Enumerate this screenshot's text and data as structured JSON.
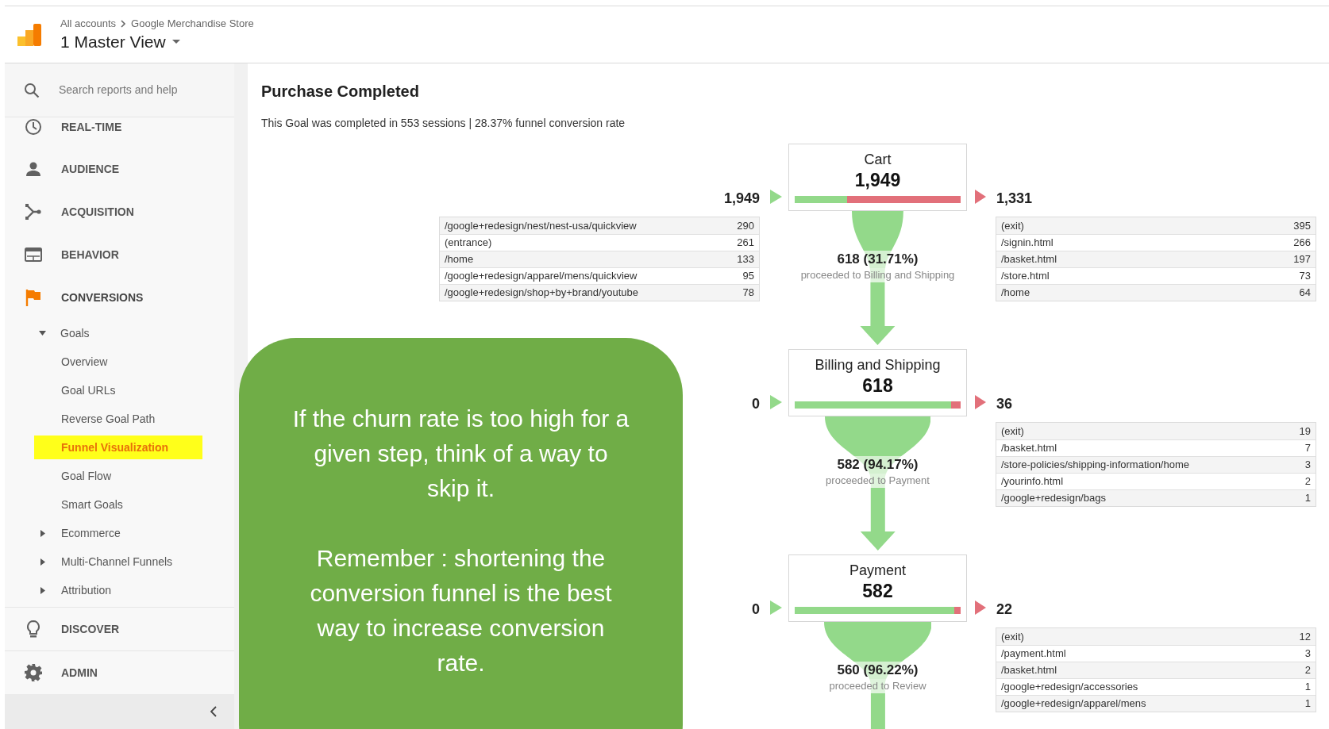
{
  "header": {
    "breadcrumb": [
      "All accounts",
      "Google Merchandise Store"
    ],
    "view": "1 Master View"
  },
  "sidebar": {
    "search": {
      "placeholder": "Search reports and help"
    },
    "sections": [
      {
        "label": "REAL-TIME",
        "selected": false
      },
      {
        "label": "AUDIENCE",
        "selected": false
      },
      {
        "label": "ACQUISITION",
        "selected": false
      },
      {
        "label": "BEHAVIOR",
        "selected": false
      },
      {
        "label": "CONVERSIONS",
        "selected": true,
        "children": [
          {
            "label": "Goals",
            "expanded": true,
            "children": [
              {
                "label": "Overview",
                "selected": false
              },
              {
                "label": "Goal URLs",
                "selected": false
              },
              {
                "label": "Reverse Goal Path",
                "selected": false
              },
              {
                "label": "Funnel Visualization",
                "selected": true
              },
              {
                "label": "Goal Flow",
                "selected": false
              },
              {
                "label": "Smart Goals",
                "selected": false
              }
            ]
          },
          {
            "label": "Ecommerce",
            "expanded": false
          },
          {
            "label": "Multi-Channel Funnels",
            "expanded": false
          },
          {
            "label": "Attribution",
            "expanded": false
          }
        ]
      }
    ],
    "footer_sections": [
      {
        "label": "DISCOVER",
        "selected": false
      },
      {
        "label": "ADMIN",
        "selected": false
      }
    ]
  },
  "report": {
    "title": "Purchase Completed",
    "summary": "This Goal was completed in 553 sessions | 28.37% funnel conversion rate",
    "steps": [
      {
        "name": "Cart",
        "count": "1,949",
        "level": 0.3171,
        "entrances": "1,949",
        "entrance_pages": [
          {
            "page": "/google+redesign/nest/nest-usa/quickview",
            "count": "290"
          },
          {
            "page": "(entrance)",
            "count": "261"
          },
          {
            "page": "/home",
            "count": "133"
          },
          {
            "page": "/google+redesign/apparel/mens/quickview",
            "count": "95"
          },
          {
            "page": "/google+redesign/shop+by+brand/youtube",
            "count": "78"
          }
        ],
        "exits": "1,331",
        "exit_pages": [
          {
            "page": "(exit)",
            "count": "395"
          },
          {
            "page": "/signin.html",
            "count": "266"
          },
          {
            "page": "/basket.html",
            "count": "197"
          },
          {
            "page": "/store.html",
            "count": "73"
          },
          {
            "page": "/home",
            "count": "64"
          }
        ],
        "proceeded": "618 (31.71%)",
        "proceeded_label": "proceeded to Billing and Shipping"
      },
      {
        "name": "Billing and Shipping",
        "count": "618",
        "level": 0.9417,
        "entrances": "0",
        "exits": "36",
        "exit_pages": [
          {
            "page": "(exit)",
            "count": "19"
          },
          {
            "page": "/basket.html",
            "count": "7"
          },
          {
            "page": "/store-policies/shipping-information/home",
            "count": "3"
          },
          {
            "page": "/yourinfo.html",
            "count": "2"
          },
          {
            "page": "/google+redesign/bags",
            "count": "1"
          }
        ],
        "proceeded": "582 (94.17%)",
        "proceeded_label": "proceeded to Payment"
      },
      {
        "name": "Payment",
        "count": "582",
        "level": 0.9622,
        "entrances": "0",
        "exits": "22",
        "exit_pages": [
          {
            "page": "(exit)",
            "count": "12"
          },
          {
            "page": "/payment.html",
            "count": "3"
          },
          {
            "page": "/basket.html",
            "count": "2"
          },
          {
            "page": "/google+redesign/accessories",
            "count": "1"
          },
          {
            "page": "/google+redesign/apparel/mens",
            "count": "1"
          }
        ],
        "proceeded": "560 (96.22%)",
        "proceeded_label": "proceeded to Review"
      }
    ]
  },
  "callout": {
    "paragraphs": [
      "If the churn rate is too high for a given step, think of a way to skip it.",
      "Remember : shortening the conversion funnel is the best way to increase conversion rate."
    ]
  }
}
